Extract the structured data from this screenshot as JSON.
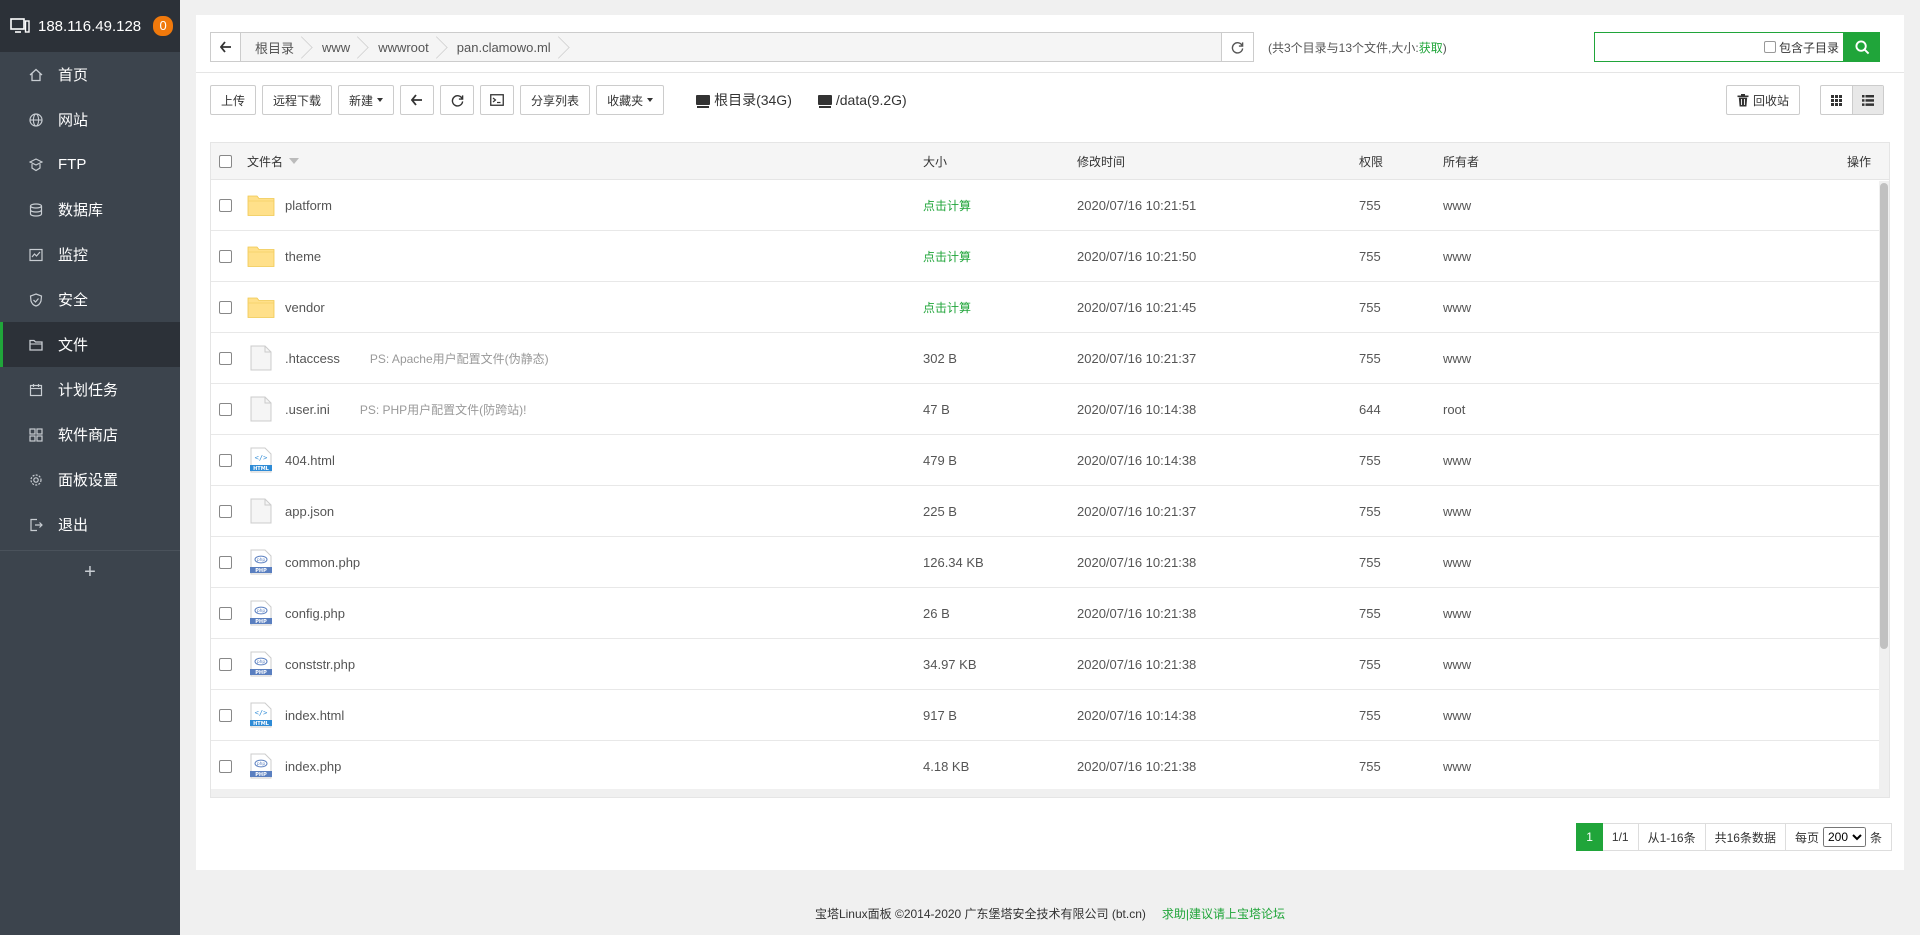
{
  "sidebar": {
    "server_ip": "188.116.49.128",
    "notice_count": "0",
    "items": [
      {
        "label": "首页",
        "icon": "home-icon"
      },
      {
        "label": "网站",
        "icon": "globe-icon"
      },
      {
        "label": "FTP",
        "icon": "ftp-icon"
      },
      {
        "label": "数据库",
        "icon": "database-icon"
      },
      {
        "label": "监控",
        "icon": "monitor-icon"
      },
      {
        "label": "安全",
        "icon": "shield-icon"
      },
      {
        "label": "文件",
        "icon": "folder-icon",
        "active": true
      },
      {
        "label": "计划任务",
        "icon": "calendar-icon"
      },
      {
        "label": "软件商店",
        "icon": "grid-icon"
      },
      {
        "label": "面板设置",
        "icon": "gear-icon"
      },
      {
        "label": "退出",
        "icon": "logout-icon"
      }
    ],
    "add_label": "+"
  },
  "path": {
    "crumbs": [
      "根目录",
      "www",
      "wwwroot",
      "pan.clamowo.ml"
    ],
    "info_text": "(共3个目录与13个文件,大小:",
    "info_link": "获取",
    "info_end": ")"
  },
  "search": {
    "placeholder": "",
    "subdir_label": "包含子目录"
  },
  "toolbar": {
    "upload": "上传",
    "remote_download": "远程下载",
    "new": "新建",
    "share_list": "分享列表",
    "favorites": "收藏夹",
    "disks": [
      {
        "label": "根目录(34G)"
      },
      {
        "label": "/data(9.2G)"
      }
    ],
    "recycle": "回收站"
  },
  "table": {
    "headers": {
      "name": "文件名",
      "size": "大小",
      "mtime": "修改时间",
      "perm": "权限",
      "owner": "所有者",
      "op": "操作"
    },
    "rows": [
      {
        "type": "folder",
        "name": "platform",
        "note": "",
        "size": "点击计算",
        "mtime": "2020/07/16 10:21:51",
        "perm": "755",
        "owner": "www"
      },
      {
        "type": "folder",
        "name": "theme",
        "note": "",
        "size": "点击计算",
        "mtime": "2020/07/16 10:21:50",
        "perm": "755",
        "owner": "www"
      },
      {
        "type": "folder",
        "name": "vendor",
        "note": "",
        "size": "点击计算",
        "mtime": "2020/07/16 10:21:45",
        "perm": "755",
        "owner": "www"
      },
      {
        "type": "file",
        "name": ".htaccess",
        "note": "PS: Apache用户配置文件(伪静态)",
        "size": "302 B",
        "mtime": "2020/07/16 10:21:37",
        "perm": "755",
        "owner": "www"
      },
      {
        "type": "file",
        "name": ".user.ini",
        "note": "PS: PHP用户配置文件(防跨站)!",
        "size": "47 B",
        "mtime": "2020/07/16 10:14:38",
        "perm": "644",
        "owner": "root"
      },
      {
        "type": "html",
        "name": "404.html",
        "note": "",
        "size": "479 B",
        "mtime": "2020/07/16 10:14:38",
        "perm": "755",
        "owner": "www"
      },
      {
        "type": "file",
        "name": "app.json",
        "note": "",
        "size": "225 B",
        "mtime": "2020/07/16 10:21:37",
        "perm": "755",
        "owner": "www"
      },
      {
        "type": "php",
        "name": "common.php",
        "note": "",
        "size": "126.34 KB",
        "mtime": "2020/07/16 10:21:38",
        "perm": "755",
        "owner": "www"
      },
      {
        "type": "php",
        "name": "config.php",
        "note": "",
        "size": "26 B",
        "mtime": "2020/07/16 10:21:38",
        "perm": "755",
        "owner": "www"
      },
      {
        "type": "php",
        "name": "conststr.php",
        "note": "",
        "size": "34.97 KB",
        "mtime": "2020/07/16 10:21:38",
        "perm": "755",
        "owner": "www"
      },
      {
        "type": "html",
        "name": "index.html",
        "note": "",
        "size": "917 B",
        "mtime": "2020/07/16 10:14:38",
        "perm": "755",
        "owner": "www"
      },
      {
        "type": "php",
        "name": "index.php",
        "note": "",
        "size": "4.18 KB",
        "mtime": "2020/07/16 10:21:38",
        "perm": "755",
        "owner": "www"
      }
    ]
  },
  "pagination": {
    "current": "1",
    "pages": "1/1",
    "range": "从1-16条",
    "total": "共16条数据",
    "per_page_label": "每页",
    "per_page_value": "200",
    "unit": "条"
  },
  "footer": {
    "copyright": "宝塔Linux面板 ©2014-2020 广东堡塔安全技术有限公司 (bt.cn)",
    "link": "求助|建议请上宝塔论坛"
  },
  "colors": {
    "accent": "#20a53a",
    "sidebar_bg": "#3c444d",
    "sidebar_header_bg": "#2c3138",
    "badge": "#f0790c",
    "folder": "#ffe08a"
  }
}
